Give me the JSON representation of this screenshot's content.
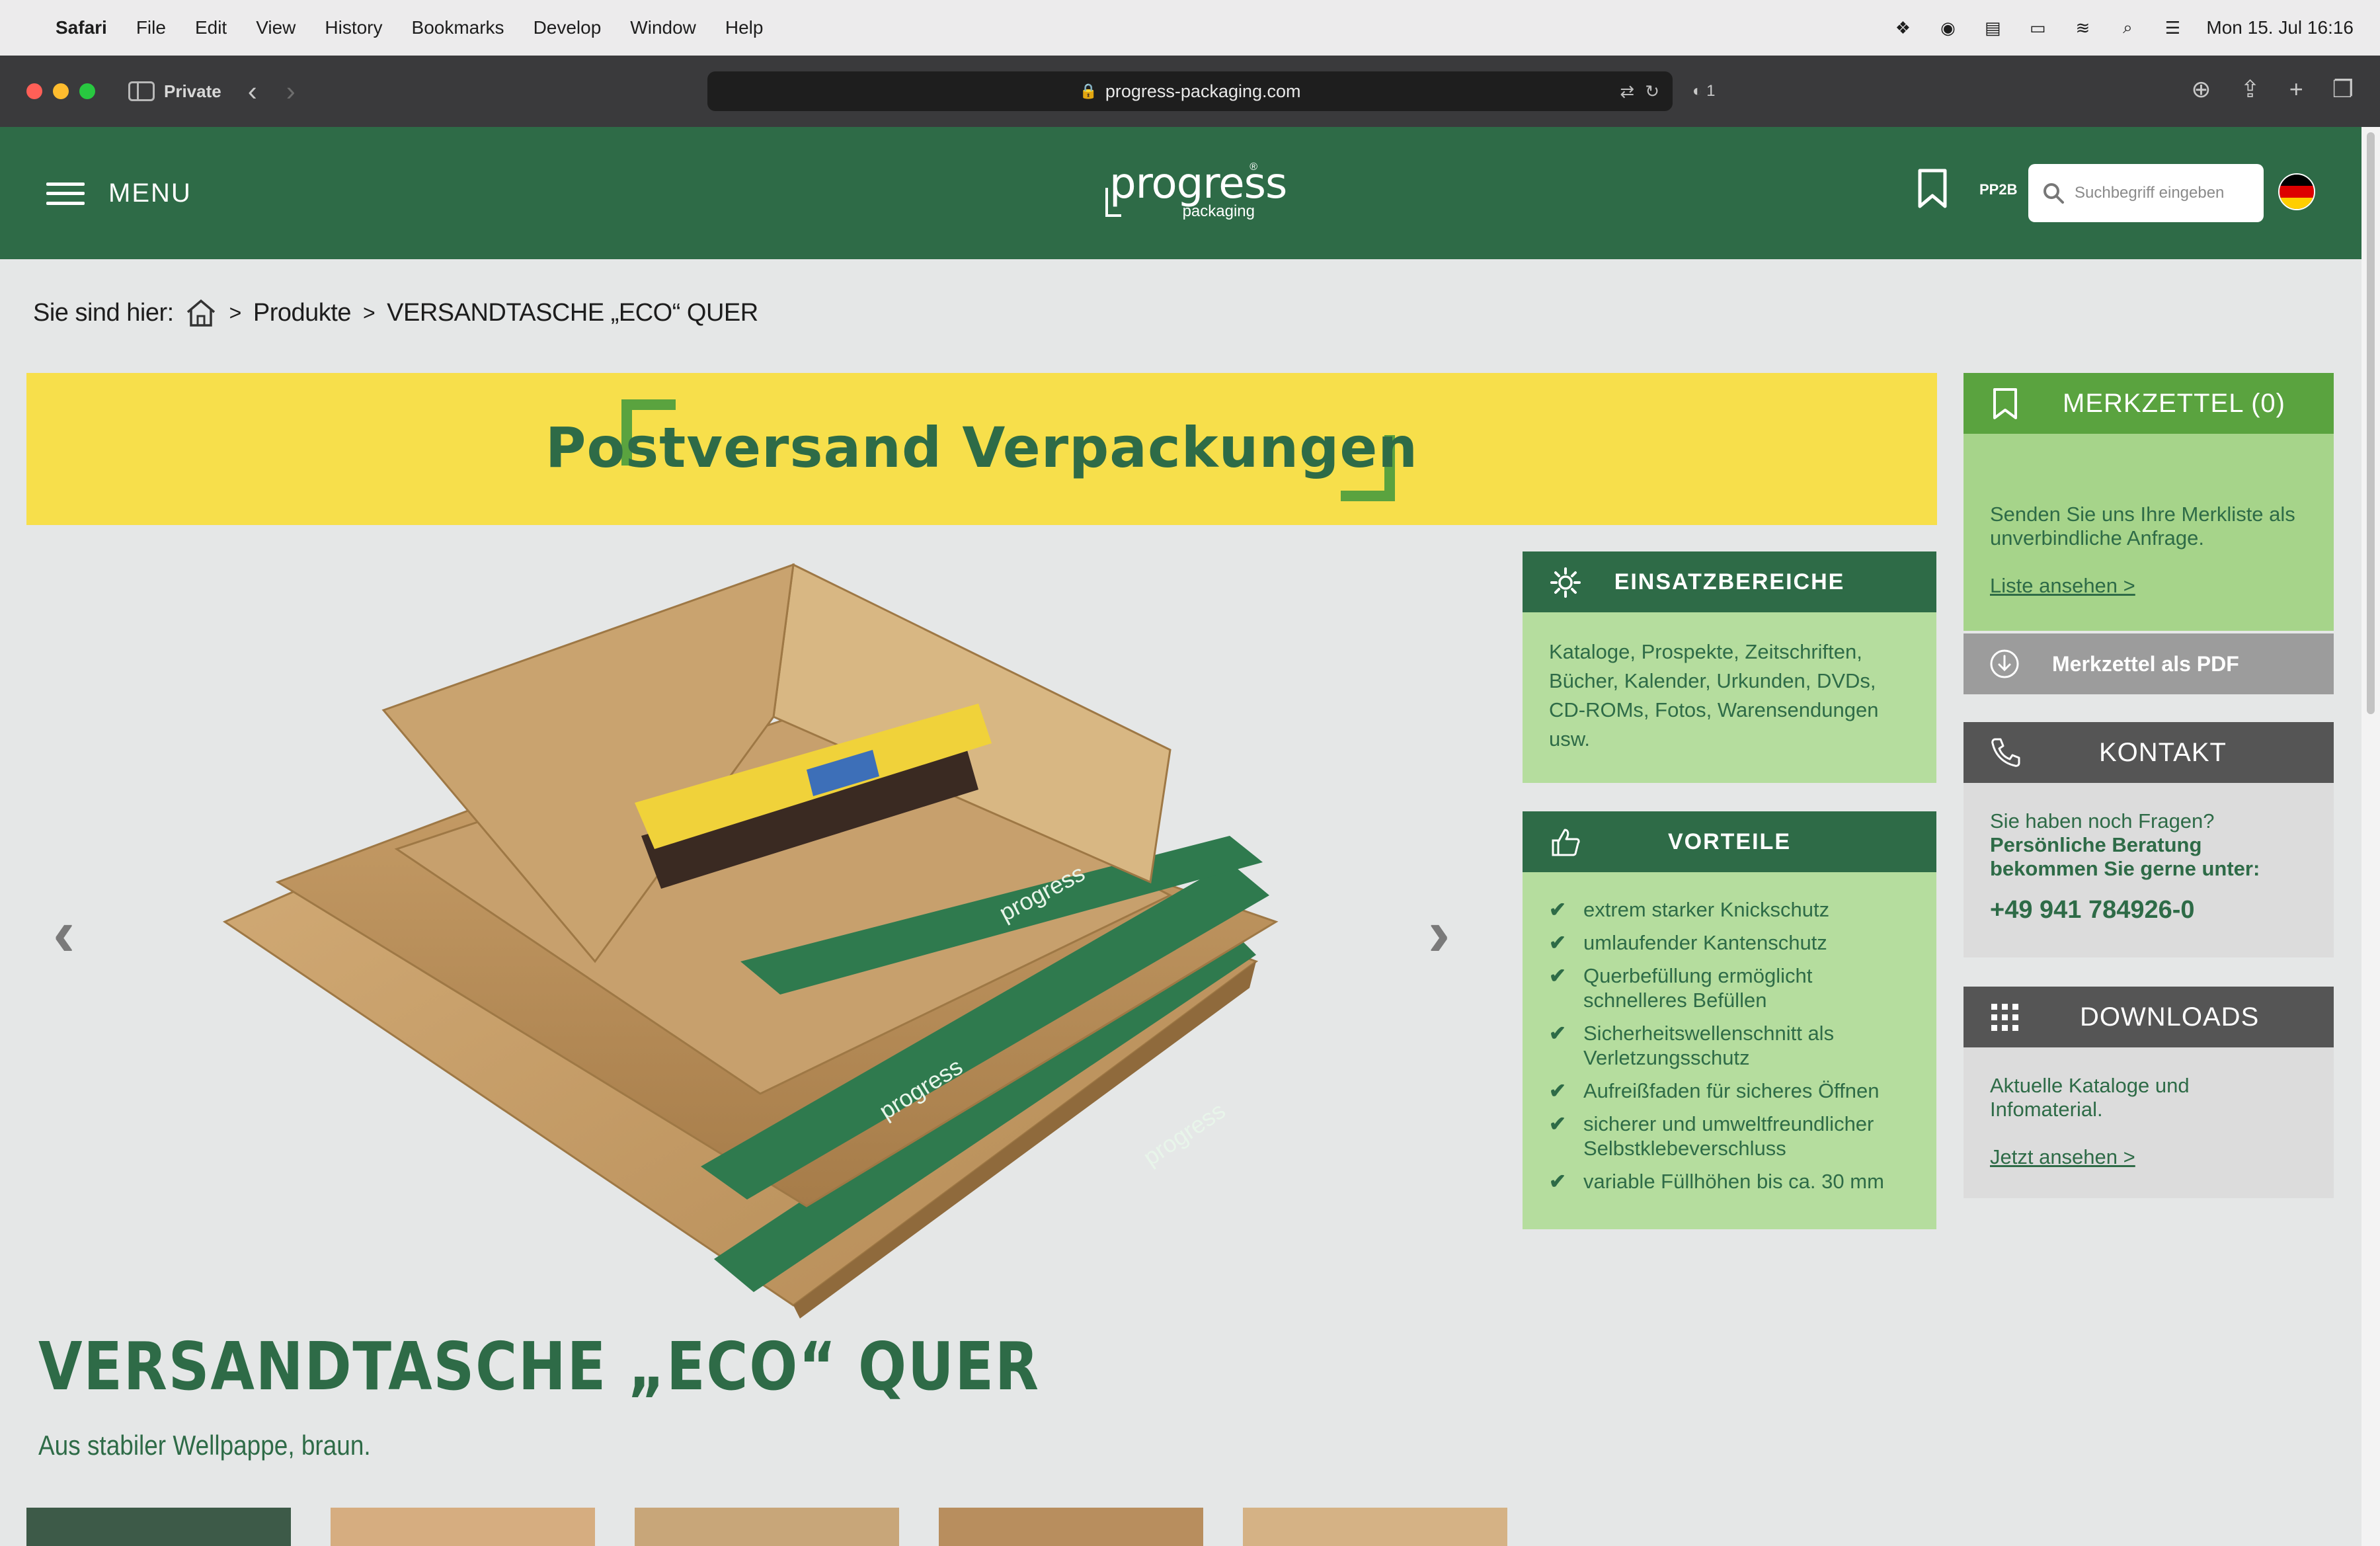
{
  "mac_menu": {
    "app": "Safari",
    "items": [
      "File",
      "Edit",
      "View",
      "History",
      "Bookmarks",
      "Develop",
      "Window",
      "Help"
    ],
    "clock": "Mon 15. Jul  16:16"
  },
  "browser": {
    "mode_label": "Private",
    "url": "progress-packaging.com",
    "tracker_count": "1"
  },
  "header": {
    "menu_label": "MENU",
    "logo_word": "progress",
    "logo_sub": "packaging",
    "logo_reg": "®",
    "pp2b": "PP2B",
    "search_placeholder": "Suchbegriff eingeben"
  },
  "breadcrumb": {
    "prefix": "Sie sind hier:",
    "items": [
      "Produkte",
      "VERSANDTASCHE „ECO“ QUER"
    ]
  },
  "banner": {
    "title": "Postversand Verpackungen"
  },
  "einsatz": {
    "title": "EINSATZBEREICHE",
    "text": "Kataloge, Prospekte, Zeitschriften, Bücher, Kalender, Urkunden, DVDs, CD-ROMs, Fotos, Warensendungen usw."
  },
  "vorteile": {
    "title": "VORTEILE",
    "items": [
      "extrem starker Knickschutz",
      "umlaufender Kantenschutz",
      "Querbefüllung ermöglicht schnelleres Befüllen",
      "Sicherheitswellenschnitt als Verletzungsschutz",
      "Aufreißfaden für sicheres Öffnen",
      "sicherer und umweltfreundlicher Selbstklebeverschluss",
      "variable Füllhöhen bis ca. 30 mm"
    ]
  },
  "merkzettel": {
    "title": "MERKZETTEL (0)",
    "text": "Senden Sie uns Ihre Merkliste als unverbindliche Anfrage.",
    "link": "Liste ansehen >",
    "pdf_label": "Merkzettel als PDF"
  },
  "kontakt": {
    "title": "KONTAKT",
    "question": "Sie haben noch Fragen?",
    "strong": "Persönliche Beratung bekommen Sie gerne unter:",
    "phone": "+49 941 784926-0"
  },
  "downloads": {
    "title": "DOWNLOADS",
    "text": "Aktuelle Kataloge und Infomaterial.",
    "link": "Jetzt ansehen >"
  },
  "product": {
    "title": "VERSANDTASCHE „ECO“ QUER",
    "subtitle": "Aus stabiler Wellpappe, braun.",
    "stripe_text": "progress"
  },
  "colors": {
    "brand_green": "#2e6b47",
    "light_green": "#b5dd9e",
    "accent_green": "#5aa33f",
    "banner_yellow": "#f7df4b",
    "grey_dark": "#555555",
    "grey_light": "#dcdcdc"
  }
}
